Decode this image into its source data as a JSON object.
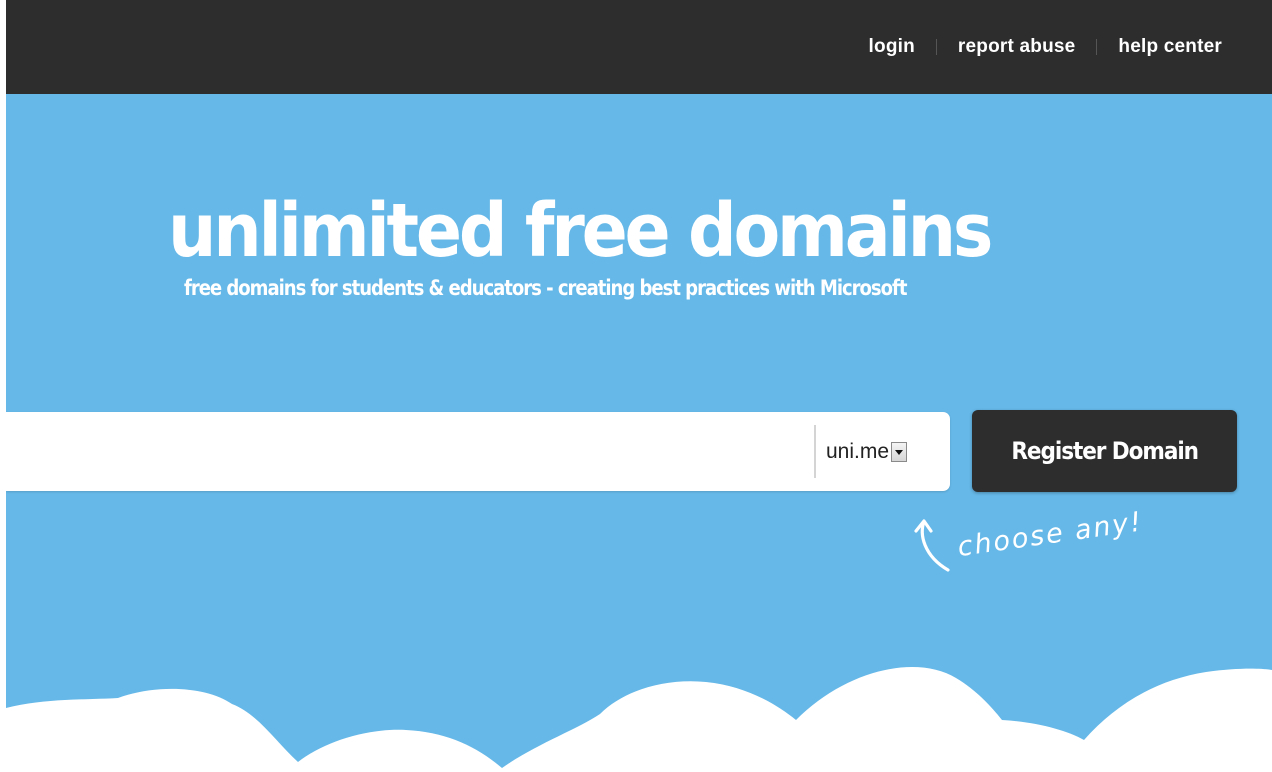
{
  "nav": {
    "login": "login",
    "report_abuse": "report abuse",
    "help_center": "help center"
  },
  "hero": {
    "title": "unlimited free domains",
    "tagline": "free domains for students & educators - creating best practices with Microsoft"
  },
  "search": {
    "value": "",
    "extension": "uni.me"
  },
  "register_button": "Register Domain",
  "hint": "choose any!",
  "colors": {
    "topbar": "#2d2d2d",
    "hero_background": "#66b8e8",
    "text": "#ffffff",
    "button": "#2d2d2d"
  },
  "icons": {
    "dropdown": "chevron-down-icon",
    "hint": "curved-arrow-icon",
    "decoration": "clouds"
  }
}
